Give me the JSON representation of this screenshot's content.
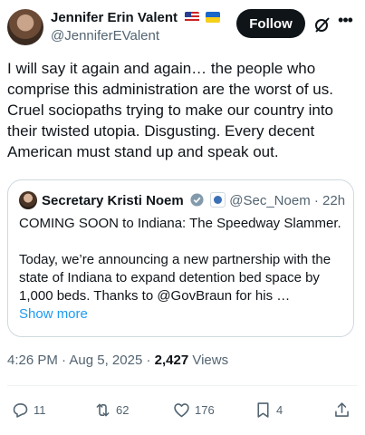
{
  "author": {
    "display_name": "Jennifer Erin Valent",
    "handle": "@JenniferEValent",
    "flags": [
      "us-flag",
      "ukraine-flag"
    ]
  },
  "follow_label": "Follow",
  "tweet_text": "I will say it again and again… the people who comprise this administration are the worst of us. Cruel sociopaths trying to make our country into their twisted utopia. Disgusting. Every decent American must stand up and speak out.",
  "quote": {
    "display_name": "Secretary Kristi Noem",
    "handle": "@Sec_Noem",
    "separator": "·",
    "time": "22h",
    "line1": "COMING SOON to Indiana: The Speedway Slammer.",
    "line2": "Today, we’re announcing a new partnership with the state of Indiana to expand detention bed space by 1,000 beds. Thanks to @GovBraun for his …",
    "show_more": "Show more"
  },
  "meta": {
    "time": "4:26 PM",
    "separator": "·",
    "date": "Aug 5, 2025",
    "separator2": "·",
    "views_count": "2,427",
    "views_label": "Views"
  },
  "actions": {
    "replies": "11",
    "reposts": "62",
    "likes": "176",
    "bookmarks": "4"
  },
  "colors": {
    "text": "#0f1419",
    "secondary": "#536471",
    "link": "#1d9bf0",
    "border": "#cfd9de",
    "button": "#0f1419"
  }
}
